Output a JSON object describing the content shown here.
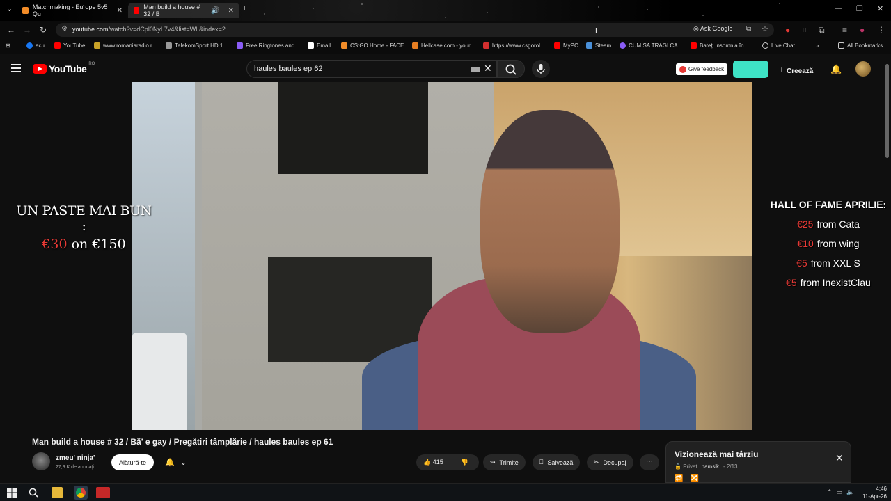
{
  "browser": {
    "tabs": [
      {
        "title": "Matchmaking - Europe 5v5 Qu",
        "active": false
      },
      {
        "title": "Man build a house # 32 / B",
        "active": true
      }
    ],
    "url_host": "youtube.com",
    "url_path": "/watch?v=dCpl0NyL7v4&list=WL&index=2",
    "ask_google": "Ask Google",
    "bookmarks": [
      "acu",
      "YouTube",
      "www.romaniaradio.r...",
      "TelekomSport HD 1...",
      "Free Ringtones and...",
      "Email",
      "CS:GO Home - FACE...",
      "Hellcase.com - your...",
      "https://www.csgorol...",
      "MyPC",
      "Steam",
      "CUM SA TRAGI CA...",
      "Bateți insomnia în...",
      "Live Chat"
    ],
    "all_bookmarks": "All Bookmarks"
  },
  "youtube": {
    "logo_text": "YouTube",
    "region": "RO",
    "search_value": "haules baules ep 62",
    "give_feedback": "Give feedback",
    "create_label": "Creează"
  },
  "overlay": {
    "promo_title": "UN PASTE MAI BUN :",
    "promo_amount": "€30",
    "promo_on": "on €150",
    "hof_title": "HALL OF FAME APRILIE:",
    "hof_rows": [
      {
        "amount": "€25",
        "from": "from Cata"
      },
      {
        "amount": "€10",
        "from": "from wing"
      },
      {
        "amount": "€5",
        "from": "from XXL S"
      },
      {
        "amount": "€5",
        "from": "from InexistClau"
      }
    ]
  },
  "video": {
    "title": "Man build a house # 32 / Bă' e gay / Pregătiri tâmplărie / haules baules ep 61",
    "channel": "zmeu' ninja'",
    "subscribers": "27,9 K de abonați",
    "join_label": "Alătură-te",
    "likes": "415",
    "share_label": "Trimite",
    "save_label": "Salvează",
    "clip_label": "Decupaj"
  },
  "watch_later": {
    "title": "Vizionează mai târziu",
    "privacy": "Privat",
    "owner": "hamsik",
    "position": "2/13"
  },
  "system": {
    "time": "4:46",
    "date": "11-Apr-26"
  },
  "colors": {
    "accent": "#ff0000",
    "overlay_red": "#e53935",
    "ext_button": "#3ee3c6"
  }
}
